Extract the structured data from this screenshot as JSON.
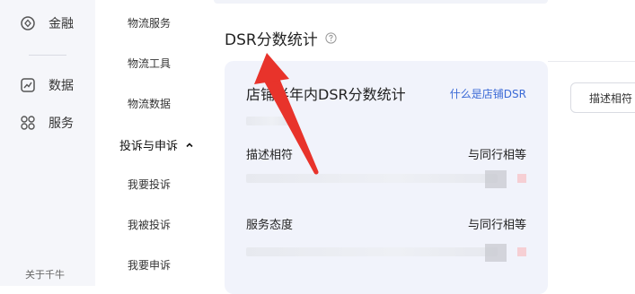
{
  "rail": {
    "items": [
      {
        "label": "金融",
        "icon": "finance-circle-icon"
      },
      {
        "label": "数据",
        "icon": "chart-line-icon"
      },
      {
        "label": "服务",
        "icon": "grid-dots-icon"
      }
    ],
    "footer": "关于千牛"
  },
  "submenu": {
    "items_top": [
      "物流服务",
      "物流工具",
      "物流数据"
    ],
    "group_label": "投诉与申诉",
    "group_items": [
      "我要投诉",
      "我被投诉",
      "我要申诉"
    ]
  },
  "main": {
    "section_title": "DSR分数统计",
    "panel": {
      "title": "店铺半年内DSR分数统计",
      "link": "什么是店铺DSR",
      "metrics": [
        {
          "label": "描述相符",
          "value": "与同行相等"
        },
        {
          "label": "服务态度",
          "value": "与同行相等"
        }
      ]
    },
    "tab_button": "描述相符"
  },
  "colors": {
    "accent_link": "#3b6ad6",
    "arrow": "#e8332b",
    "rail_bg": "#f5f6fa",
    "panel_bg": "#f1f3fb"
  }
}
